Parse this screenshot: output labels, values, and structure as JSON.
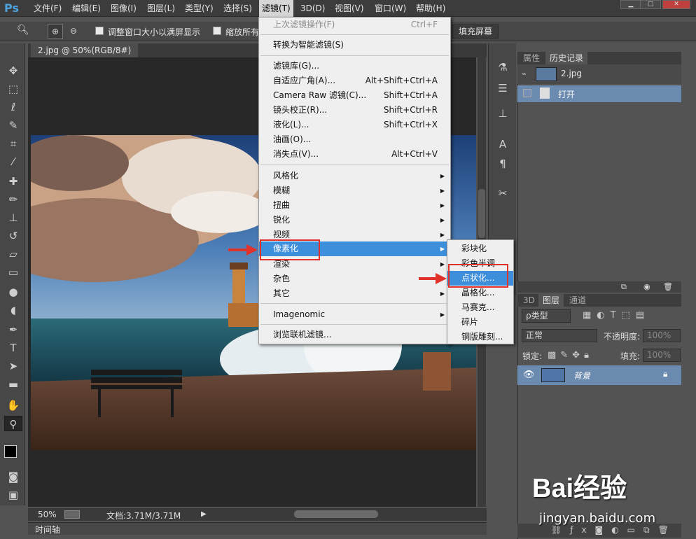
{
  "app": {
    "logo": "Ps"
  },
  "menubar": [
    "文件(F)",
    "编辑(E)",
    "图像(I)",
    "图层(L)",
    "类型(Y)",
    "选择(S)",
    "滤镜(T)",
    "3D(D)",
    "视图(V)",
    "窗口(W)",
    "帮助(H)"
  ],
  "window_controls": [
    "minimize-icon",
    "restore-icon",
    "close-icon"
  ],
  "options": {
    "check1": "调整窗口大小以满屏显示",
    "check2": "缩放所有",
    "fill_screen": "填充屏幕"
  },
  "document": {
    "tab": "2.jpg @ 50%(RGB/8#)",
    "zoom": "50%",
    "doc_info": "文档:3.71M/3.71M",
    "timeline": "时间轴"
  },
  "filter_menu": {
    "last_filter": {
      "label": "上次滤镜操作(F)",
      "shortcut": "Ctrl+F"
    },
    "smart": "转换为智能滤镜(S)",
    "group1": [
      {
        "label": "滤镜库(G)...",
        "shortcut": ""
      },
      {
        "label": "自适应广角(A)...",
        "shortcut": "Alt+Shift+Ctrl+A"
      },
      {
        "label": "Camera Raw 滤镜(C)...",
        "shortcut": "Shift+Ctrl+A"
      },
      {
        "label": "镜头校正(R)...",
        "shortcut": "Shift+Ctrl+R"
      },
      {
        "label": "液化(L)...",
        "shortcut": "Shift+Ctrl+X"
      },
      {
        "label": "油画(O)...",
        "shortcut": ""
      },
      {
        "label": "消失点(V)...",
        "shortcut": "Alt+Ctrl+V"
      }
    ],
    "group2": [
      "风格化",
      "模糊",
      "扭曲",
      "锐化",
      "视频",
      "像素化",
      "渲染",
      "杂色",
      "其它"
    ],
    "imagenomic": "Imagenomic",
    "browse": "浏览联机滤镜..."
  },
  "pixelate_submenu": [
    "彩块化",
    "彩色半调",
    "点状化...",
    "晶格化...",
    "马赛克...",
    "碎片",
    "铜版雕刻..."
  ],
  "history": {
    "tabs": [
      "属性",
      "历史记录"
    ],
    "snapshot": "2.jpg",
    "step": "打开"
  },
  "layers": {
    "tabs": [
      "3D",
      "图层",
      "通道"
    ],
    "filter": "ρ类型",
    "blend": "正常",
    "opacity_label": "不透明度:",
    "opacity": "100%",
    "lock_label": "锁定:",
    "fill_label": "填充:",
    "fill": "100%",
    "layer_name": "背景"
  },
  "watermark": {
    "brand": "Bai经验",
    "url": "jingyan.baidu.com"
  },
  "colors": {
    "highlight": "#3d8fdc",
    "annotation": "#e0312b",
    "selection": "#6b8ab0"
  }
}
